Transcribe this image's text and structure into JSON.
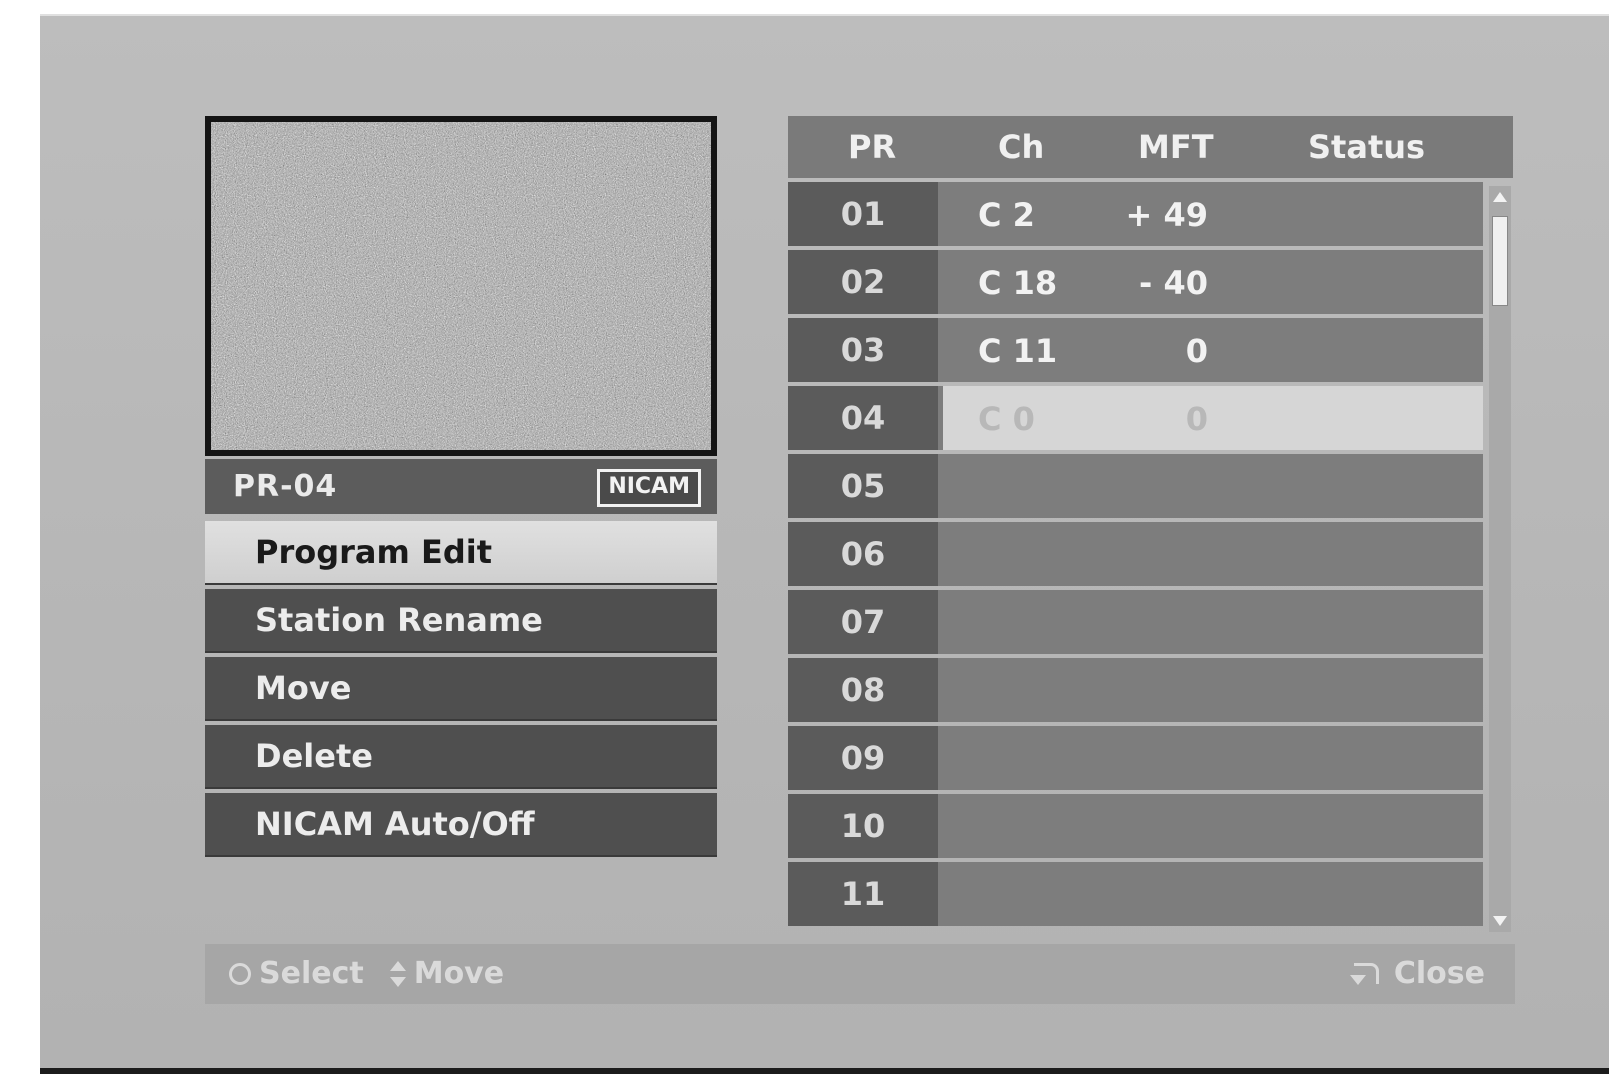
{
  "preview": {
    "label": "PR-04",
    "badge": "NICAM"
  },
  "menu": {
    "items": [
      {
        "label": "Program Edit",
        "selected": true
      },
      {
        "label": "Station Rename",
        "selected": false
      },
      {
        "label": "Move",
        "selected": false
      },
      {
        "label": "Delete",
        "selected": false
      },
      {
        "label": "NICAM Auto/Off",
        "selected": false
      }
    ]
  },
  "table": {
    "headers": {
      "pr": "PR",
      "ch": "Ch",
      "mft": "MFT",
      "status": "Status"
    },
    "rows": [
      {
        "pr": "01",
        "ch": "C 2",
        "mft": "+ 49",
        "status": ""
      },
      {
        "pr": "02",
        "ch": "C 18",
        "mft": "- 40",
        "status": ""
      },
      {
        "pr": "03",
        "ch": "C 11",
        "mft": "0",
        "status": ""
      },
      {
        "pr": "04",
        "ch": "C 0",
        "mft": "0",
        "status": ""
      },
      {
        "pr": "05",
        "ch": "",
        "mft": "",
        "status": ""
      },
      {
        "pr": "06",
        "ch": "",
        "mft": "",
        "status": ""
      },
      {
        "pr": "07",
        "ch": "",
        "mft": "",
        "status": ""
      },
      {
        "pr": "08",
        "ch": "",
        "mft": "",
        "status": ""
      },
      {
        "pr": "09",
        "ch": "",
        "mft": "",
        "status": ""
      },
      {
        "pr": "10",
        "ch": "",
        "mft": "",
        "status": ""
      },
      {
        "pr": "11",
        "ch": "",
        "mft": "",
        "status": ""
      }
    ],
    "selected_row_index": 3
  },
  "footer": {
    "select_label": "Select",
    "move_label": "Move",
    "close_label": "Close"
  },
  "icons": {
    "select": "ok-circle-icon",
    "move": "up-down-arrows-icon",
    "close": "return-icon"
  }
}
